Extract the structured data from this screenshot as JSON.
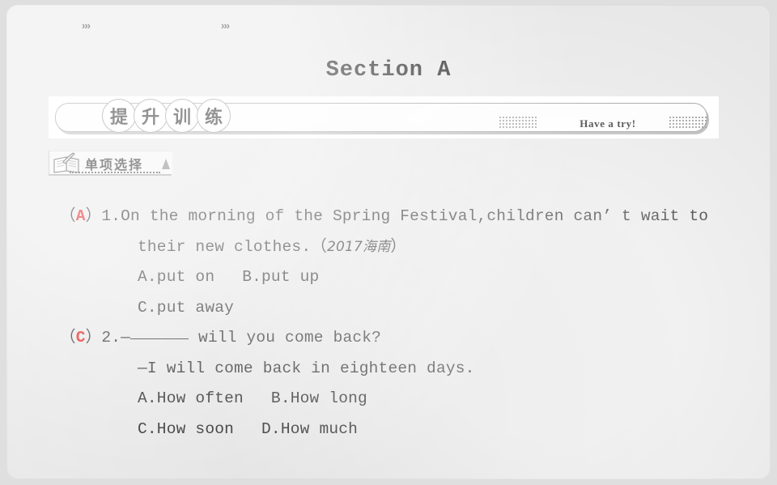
{
  "slide": {
    "title": "Section A",
    "background_color": "#e7e7e7"
  },
  "banner": {
    "chevron_left": "›››",
    "chevron_right": "›››",
    "circle_chars": [
      "提",
      "升",
      "训",
      "练"
    ],
    "phrase": "提升训练",
    "have_a_try": "Have a try!"
  },
  "subheader": {
    "icon": "book-quill-icon",
    "label": "单项选择"
  },
  "questions": [
    {
      "marker_open": "（",
      "answer": "A",
      "answer_color": "#e00000",
      "marker_close": "）",
      "number": "1.",
      "stem_line1": "On the morning of the Spring Festival,children can’ t wait to",
      "stem_line2_pre": "their new clothes.（",
      "stem_line2_source": "2017海南",
      "stem_line2_post": "）",
      "options_row1": [
        "A.put on",
        "B.put up"
      ],
      "options_row2": [
        "C.put away"
      ]
    },
    {
      "marker_open": "（",
      "answer": "C",
      "answer_color": "#e00000",
      "marker_close": "）",
      "number": "2.",
      "stem_line1_pre": "—",
      "stem_line1_post": "will you come back?",
      "stem_line2": "—I will come back in eighteen days.",
      "options_row1": [
        "A.How often",
        "B.How long"
      ],
      "options_row2": [
        "C.How soon",
        "D.How much"
      ]
    }
  ]
}
